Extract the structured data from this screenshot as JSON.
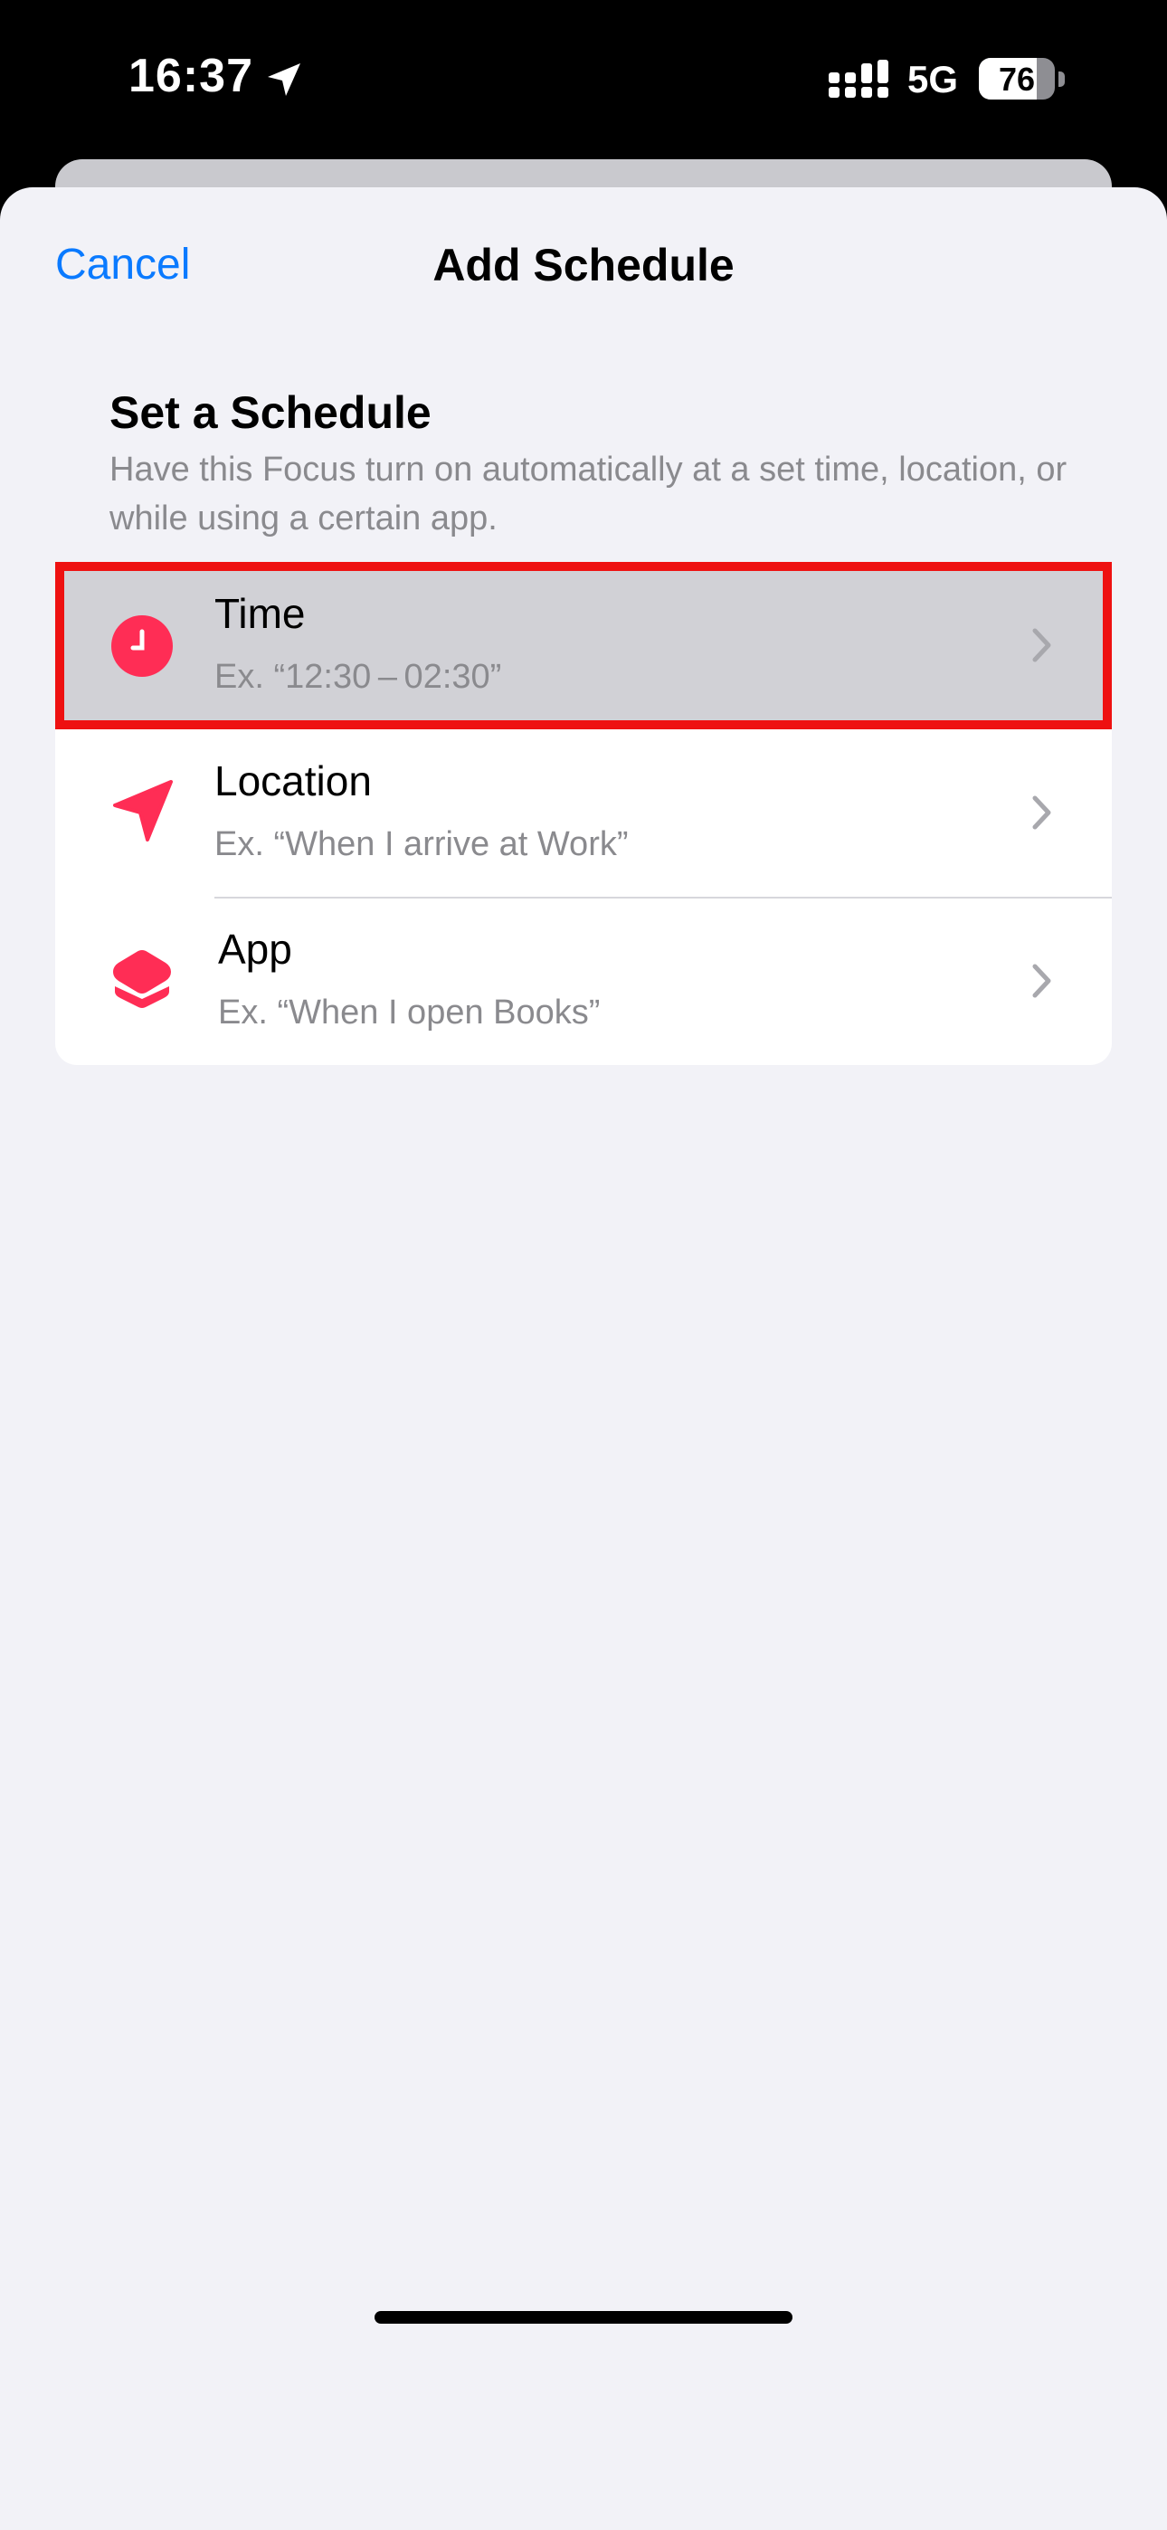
{
  "status_bar": {
    "time": "16:37",
    "network": "5G",
    "battery_level": "76",
    "battery_fraction": 0.76,
    "icons": [
      "location-arrow-icon",
      "signal-icon",
      "battery-icon"
    ]
  },
  "nav": {
    "cancel_label": "Cancel",
    "title": "Add Schedule"
  },
  "section": {
    "title": "Set a Schedule",
    "description": "Have this Focus turn on automatically at a set time, location, or while using a certain app."
  },
  "options": [
    {
      "title": "Time",
      "subtitle": "Ex. “12:30 – 02:30”",
      "icon": "clock-icon",
      "highlighted": true
    },
    {
      "title": "Location",
      "subtitle": "Ex. “When I arrive at Work”",
      "icon": "location-arrow-icon"
    },
    {
      "title": "App",
      "subtitle": "Ex. “When I open Books”",
      "icon": "app-layers-icon"
    }
  ],
  "colors": {
    "accent": "#0a7aff",
    "icon_pink": "#ff2d55",
    "highlight_border": "#ee1111",
    "background": "#f2f2f7"
  }
}
